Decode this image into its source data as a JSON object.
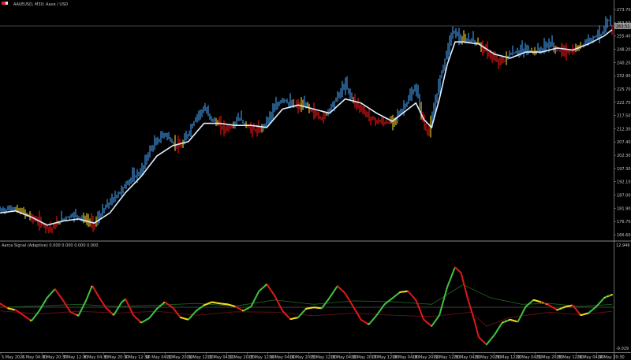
{
  "header": {
    "title": "AAVEUSD, M30:  Aave / USD"
  },
  "price_axis": {
    "ticks": [
      "273.70",
      "263.50",
      "255.40",
      "248.20",
      "240.20",
      "232.90",
      "225.70",
      "222.70",
      "217.50",
      "212.30",
      "207.40",
      "202.30",
      "197.30",
      "192.10",
      "187.00",
      "181.90",
      "176.70",
      "166.60"
    ],
    "current_price": "263.51"
  },
  "indicator": {
    "title": "Aarca Signal (Adaptive) 0.000 0.000 0.000 0.000",
    "top_label": "12.946",
    "bottom_label": "-9.029"
  },
  "time_axis": {
    "labels": [
      "5 May 2025",
      "6 May 04:30",
      "6 May 20:30",
      "7 May 12:30",
      "8 May 04:30",
      "8 May 20:30",
      "9 May 12:30",
      "10 May 04:30",
      "10 May 20:30",
      "11 May 12:30",
      "12 May 04:30",
      "12 May 20:30",
      "13 May 12:30",
      "14 May 04:30",
      "14 May 20:30",
      "15 May 12:30",
      "16 May 04:30",
      "16 May 20:30",
      "17 May 12:30",
      "18 May 04:30",
      "18 May 20:30",
      "19 May 12:30",
      "20 May 04:30",
      "20 May 20:30",
      "21 May 12:30",
      "22 May 04:30",
      "22 May 20:30",
      "23 May 12:30",
      "24 May 04:30",
      "24 May 20:30"
    ]
  },
  "colors": {
    "background": "#000000",
    "up": "#3f8fdd",
    "down": "#dc1414",
    "neutral": "#e0c020",
    "ma": "#dfefff",
    "osc_up": "#40c040",
    "osc_flat": "#f0dc1e",
    "osc_down": "#e01818",
    "text": "#c8c8c8"
  },
  "chart_data": [
    {
      "type": "line",
      "title": "AAVEUSD, M30:  Aave / USD",
      "ylabel": "",
      "xlabel": "",
      "ylim": [
        163.5,
        276.5
      ],
      "grid": false,
      "price_points": [
        {
          "t": 0,
          "v": 176
        },
        {
          "t": 3,
          "v": 177
        },
        {
          "t": 6,
          "v": 175
        },
        {
          "t": 10,
          "v": 170
        },
        {
          "t": 13,
          "v": 167
        },
        {
          "t": 16,
          "v": 172
        },
        {
          "t": 19,
          "v": 174
        },
        {
          "t": 22,
          "v": 171
        },
        {
          "t": 24,
          "v": 169
        },
        {
          "t": 27,
          "v": 178
        },
        {
          "t": 30,
          "v": 184
        },
        {
          "t": 33,
          "v": 191
        },
        {
          "t": 36,
          "v": 195
        },
        {
          "t": 38,
          "v": 205
        },
        {
          "t": 40,
          "v": 210
        },
        {
          "t": 42,
          "v": 214
        },
        {
          "t": 44,
          "v": 209
        },
        {
          "t": 46,
          "v": 207
        },
        {
          "t": 48,
          "v": 214
        },
        {
          "t": 50,
          "v": 222
        },
        {
          "t": 52,
          "v": 226
        },
        {
          "t": 54,
          "v": 221
        },
        {
          "t": 57,
          "v": 216
        },
        {
          "t": 59,
          "v": 217
        },
        {
          "t": 61,
          "v": 222
        },
        {
          "t": 62,
          "v": 219
        },
        {
          "t": 64,
          "v": 216
        },
        {
          "t": 66,
          "v": 215
        },
        {
          "t": 68,
          "v": 220
        },
        {
          "t": 70,
          "v": 226
        },
        {
          "t": 72,
          "v": 231
        },
        {
          "t": 74,
          "v": 228
        },
        {
          "t": 76,
          "v": 227
        },
        {
          "t": 78,
          "v": 228
        },
        {
          "t": 80,
          "v": 224
        },
        {
          "t": 82,
          "v": 221
        },
        {
          "t": 84,
          "v": 226
        },
        {
          "t": 86,
          "v": 232
        },
        {
          "t": 88,
          "v": 238
        },
        {
          "t": 90,
          "v": 230
        },
        {
          "t": 92,
          "v": 226
        },
        {
          "t": 94,
          "v": 222
        },
        {
          "t": 96,
          "v": 220
        },
        {
          "t": 98,
          "v": 219
        },
        {
          "t": 100,
          "v": 220
        },
        {
          "t": 102,
          "v": 224
        },
        {
          "t": 104,
          "v": 230
        },
        {
          "t": 106,
          "v": 237
        },
        {
          "t": 107,
          "v": 227
        },
        {
          "t": 108,
          "v": 218
        },
        {
          "t": 109,
          "v": 214
        },
        {
          "t": 110,
          "v": 219
        },
        {
          "t": 111,
          "v": 230
        },
        {
          "t": 112,
          "v": 240
        },
        {
          "t": 113,
          "v": 248
        },
        {
          "t": 114,
          "v": 255
        },
        {
          "t": 115,
          "v": 262
        },
        {
          "t": 116,
          "v": 265
        },
        {
          "t": 117,
          "v": 260
        },
        {
          "t": 118,
          "v": 259
        },
        {
          "t": 120,
          "v": 260
        },
        {
          "t": 122,
          "v": 258
        },
        {
          "t": 124,
          "v": 254
        },
        {
          "t": 126,
          "v": 250
        },
        {
          "t": 128,
          "v": 249
        },
        {
          "t": 130,
          "v": 253
        },
        {
          "t": 132,
          "v": 254
        },
        {
          "t": 134,
          "v": 255
        },
        {
          "t": 136,
          "v": 254
        },
        {
          "t": 138,
          "v": 255
        },
        {
          "t": 140,
          "v": 258
        },
        {
          "t": 142,
          "v": 255
        },
        {
          "t": 144,
          "v": 254
        },
        {
          "t": 146,
          "v": 254
        },
        {
          "t": 148,
          "v": 257
        },
        {
          "t": 150,
          "v": 260
        },
        {
          "t": 152,
          "v": 262
        },
        {
          "t": 154,
          "v": 263.5
        },
        {
          "t": 155,
          "v": 271
        },
        {
          "t": 156,
          "v": 264
        }
      ],
      "ma_points": [
        {
          "t": 0,
          "v": 175
        },
        {
          "t": 4,
          "v": 176
        },
        {
          "t": 8,
          "v": 173
        },
        {
          "t": 12,
          "v": 169
        },
        {
          "t": 16,
          "v": 171
        },
        {
          "t": 20,
          "v": 172
        },
        {
          "t": 24,
          "v": 170
        },
        {
          "t": 28,
          "v": 175
        },
        {
          "t": 32,
          "v": 185
        },
        {
          "t": 36,
          "v": 193
        },
        {
          "t": 40,
          "v": 203
        },
        {
          "t": 44,
          "v": 208
        },
        {
          "t": 48,
          "v": 210
        },
        {
          "t": 52,
          "v": 219
        },
        {
          "t": 56,
          "v": 219
        },
        {
          "t": 60,
          "v": 218
        },
        {
          "t": 64,
          "v": 218
        },
        {
          "t": 68,
          "v": 217
        },
        {
          "t": 72,
          "v": 226
        },
        {
          "t": 76,
          "v": 228
        },
        {
          "t": 80,
          "v": 226
        },
        {
          "t": 84,
          "v": 224
        },
        {
          "t": 88,
          "v": 231
        },
        {
          "t": 92,
          "v": 229
        },
        {
          "t": 96,
          "v": 224
        },
        {
          "t": 100,
          "v": 220
        },
        {
          "t": 104,
          "v": 226
        },
        {
          "t": 106,
          "v": 229
        },
        {
          "t": 108,
          "v": 221
        },
        {
          "t": 110,
          "v": 217
        },
        {
          "t": 112,
          "v": 231
        },
        {
          "t": 114,
          "v": 248
        },
        {
          "t": 116,
          "v": 259
        },
        {
          "t": 118,
          "v": 259
        },
        {
          "t": 122,
          "v": 258
        },
        {
          "t": 126,
          "v": 253
        },
        {
          "t": 130,
          "v": 251
        },
        {
          "t": 134,
          "v": 254
        },
        {
          "t": 138,
          "v": 254
        },
        {
          "t": 142,
          "v": 256
        },
        {
          "t": 146,
          "v": 255
        },
        {
          "t": 150,
          "v": 258
        },
        {
          "t": 154,
          "v": 262
        },
        {
          "t": 156,
          "v": 265
        }
      ]
    },
    {
      "type": "line",
      "title": "Aarca Signal (Adaptive) 0.000 0.000 0.000 0.000",
      "ylim": [
        -9.03,
        12.95
      ],
      "grid": false,
      "zero_line": 0,
      "main_points": [
        {
          "t": 0,
          "v": 1.2
        },
        {
          "t": 2,
          "v": 0.1
        },
        {
          "t": 4,
          "v": -0.3
        },
        {
          "t": 6,
          "v": -1.5
        },
        {
          "t": 8,
          "v": -2.8
        },
        {
          "t": 10,
          "v": -0.5
        },
        {
          "t": 12,
          "v": 2.5
        },
        {
          "t": 14,
          "v": 4.5
        },
        {
          "t": 16,
          "v": 2.0
        },
        {
          "t": 18,
          "v": -0.8
        },
        {
          "t": 20,
          "v": -1.6
        },
        {
          "t": 22,
          "v": 2.0
        },
        {
          "t": 23.5,
          "v": 5.3
        },
        {
          "t": 25,
          "v": 3.0
        },
        {
          "t": 27,
          "v": 0.2
        },
        {
          "t": 29,
          "v": -1.5
        },
        {
          "t": 31,
          "v": 1.5
        },
        {
          "t": 32,
          "v": 2.2
        },
        {
          "t": 34,
          "v": -1.5
        },
        {
          "t": 36,
          "v": -3.2
        },
        {
          "t": 38,
          "v": -2.2
        },
        {
          "t": 40,
          "v": 0.0
        },
        {
          "t": 42,
          "v": 1.5
        },
        {
          "t": 44,
          "v": 0.3
        },
        {
          "t": 46,
          "v": -2.0
        },
        {
          "t": 48,
          "v": -2.5
        },
        {
          "t": 50,
          "v": -0.5
        },
        {
          "t": 52,
          "v": 0.8
        },
        {
          "t": 54,
          "v": 1.5
        },
        {
          "t": 56,
          "v": 1.2
        },
        {
          "t": 58,
          "v": 1.0
        },
        {
          "t": 60,
          "v": 0.5
        },
        {
          "t": 62,
          "v": -0.5
        },
        {
          "t": 64,
          "v": 0.5
        },
        {
          "t": 66,
          "v": 4.0
        },
        {
          "t": 68,
          "v": 5.6
        },
        {
          "t": 70,
          "v": 3.0
        },
        {
          "t": 72,
          "v": -0.5
        },
        {
          "t": 74,
          "v": -2.4
        },
        {
          "t": 76,
          "v": -2.0
        },
        {
          "t": 78,
          "v": 0.0
        },
        {
          "t": 80,
          "v": 0.3
        },
        {
          "t": 82,
          "v": 0.1
        },
        {
          "t": 84,
          "v": 2.5
        },
        {
          "t": 86,
          "v": 5.2
        },
        {
          "t": 88,
          "v": 3.5
        },
        {
          "t": 90,
          "v": 0.5
        },
        {
          "t": 92,
          "v": -2.5
        },
        {
          "t": 94,
          "v": -3.6
        },
        {
          "t": 96,
          "v": -1.5
        },
        {
          "t": 98,
          "v": 1.0
        },
        {
          "t": 100,
          "v": 2.4
        },
        {
          "t": 102,
          "v": 3.8
        },
        {
          "t": 104,
          "v": 4.0
        },
        {
          "t": 106,
          "v": 2.0
        },
        {
          "t": 108,
          "v": -2.5
        },
        {
          "t": 110,
          "v": -4.0
        },
        {
          "t": 112,
          "v": -1.5
        },
        {
          "t": 114,
          "v": 5.0
        },
        {
          "t": 116,
          "v": 9.5
        },
        {
          "t": 117.5,
          "v": 8.2
        },
        {
          "t": 119,
          "v": 3.0
        },
        {
          "t": 121,
          "v": -3.0
        },
        {
          "t": 122,
          "v": -6.5
        },
        {
          "t": 124,
          "v": -8.2
        },
        {
          "t": 126,
          "v": -6.0
        },
        {
          "t": 128,
          "v": -3.2
        },
        {
          "t": 130,
          "v": -2.5
        },
        {
          "t": 132,
          "v": -3.0
        },
        {
          "t": 134,
          "v": 0.5
        },
        {
          "t": 136,
          "v": 2.0
        },
        {
          "t": 138,
          "v": 1.5
        },
        {
          "t": 140,
          "v": 0.8
        },
        {
          "t": 142,
          "v": -0.3
        },
        {
          "t": 144,
          "v": 0.4
        },
        {
          "t": 146,
          "v": 0.8
        },
        {
          "t": 148,
          "v": -1.5
        },
        {
          "t": 150,
          "v": -1.0
        },
        {
          "t": 152,
          "v": 0.5
        },
        {
          "t": 154,
          "v": 2.5
        },
        {
          "t": 156,
          "v": 3.2
        }
      ],
      "signal_up_points": [
        {
          "t": 0,
          "v": 0.3
        },
        {
          "t": 10,
          "v": 0.6
        },
        {
          "t": 20,
          "v": 1.0
        },
        {
          "t": 30,
          "v": 0.5
        },
        {
          "t": 40,
          "v": 0.8
        },
        {
          "t": 50,
          "v": 1.2
        },
        {
          "t": 60,
          "v": 0.6
        },
        {
          "t": 70,
          "v": 2.0
        },
        {
          "t": 80,
          "v": 1.0
        },
        {
          "t": 90,
          "v": 1.8
        },
        {
          "t": 100,
          "v": 1.6
        },
        {
          "t": 110,
          "v": 1.0
        },
        {
          "t": 118,
          "v": 5.5
        },
        {
          "t": 125,
          "v": 2.5
        },
        {
          "t": 133,
          "v": 1.0
        },
        {
          "t": 140,
          "v": 1.2
        },
        {
          "t": 148,
          "v": 0.5
        },
        {
          "t": 156,
          "v": 1.0
        }
      ],
      "signal_down_points": [
        {
          "t": 0,
          "v": -0.5
        },
        {
          "t": 10,
          "v": -1.2
        },
        {
          "t": 20,
          "v": -0.6
        },
        {
          "t": 30,
          "v": -1.0
        },
        {
          "t": 40,
          "v": -0.6
        },
        {
          "t": 50,
          "v": -1.5
        },
        {
          "t": 60,
          "v": -0.7
        },
        {
          "t": 70,
          "v": -0.8
        },
        {
          "t": 80,
          "v": -1.6
        },
        {
          "t": 90,
          "v": -1.0
        },
        {
          "t": 100,
          "v": -1.5
        },
        {
          "t": 110,
          "v": -1.8
        },
        {
          "t": 120,
          "v": -0.8
        },
        {
          "t": 124,
          "v": -4.0
        },
        {
          "t": 130,
          "v": -2.0
        },
        {
          "t": 140,
          "v": -0.8
        },
        {
          "t": 148,
          "v": -1.4
        },
        {
          "t": 156,
          "v": -0.6
        }
      ]
    }
  ]
}
